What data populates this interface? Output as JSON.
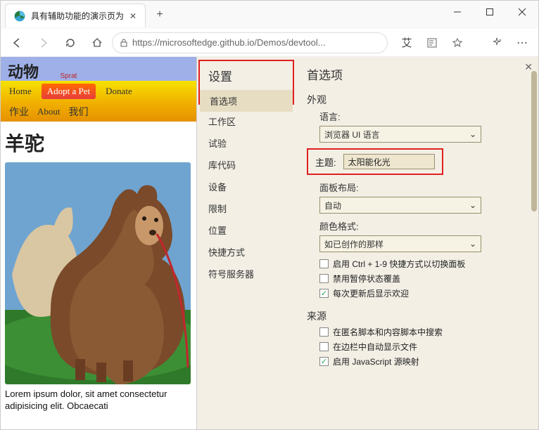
{
  "titlebar": {
    "tab_title": "具有辅助功能的演示页为",
    "url": "https://microsoftedge.github.io/Demos/devtool...",
    "ai_label": "艾"
  },
  "page": {
    "header": "动物",
    "nav1": {
      "home": "Home",
      "adopt": "Adopt a Pet",
      "sprat": "Sprat",
      "donate": "Donate"
    },
    "nav2": {
      "jobs": "作业",
      "about": "About",
      "us": "我们"
    },
    "h1": "羊驼",
    "lorem": "Lorem ipsum dolor, sit amet consectetur adipisicing elit. Obcaecati"
  },
  "devtools": {
    "title": "设置",
    "sidebar": [
      "首选项",
      "工作区",
      "试验",
      "库代码",
      "设备",
      "限制",
      "位置",
      "快捷方式",
      "符号服务器"
    ],
    "sidebar_active_index": 0,
    "prefs_title": "首选项",
    "appearance_section": "外观",
    "language_label": "语言:",
    "language_value": "浏览器 UI 语言",
    "theme_label": "主题:",
    "theme_value": "太阳能化光",
    "panel_layout_label": "面板布局:",
    "panel_layout_value": "自动",
    "color_format_label": "颜色格式:",
    "color_format_value": "如已创作的那样",
    "cb_shortcut": "启用 Ctrl + 1-9 快捷方式以切换面板",
    "cb_pause": "禁用暂停状态覆盖",
    "cb_welcome": "每次更新后显示欢迎",
    "sources_section": "来源",
    "cb_anon": "在匿名脚本和内容脚本中搜索",
    "cb_sidebar_files": "在边栏中自动显示文件",
    "cb_js_sourcemap": "启用 JavaScript 源映射"
  }
}
